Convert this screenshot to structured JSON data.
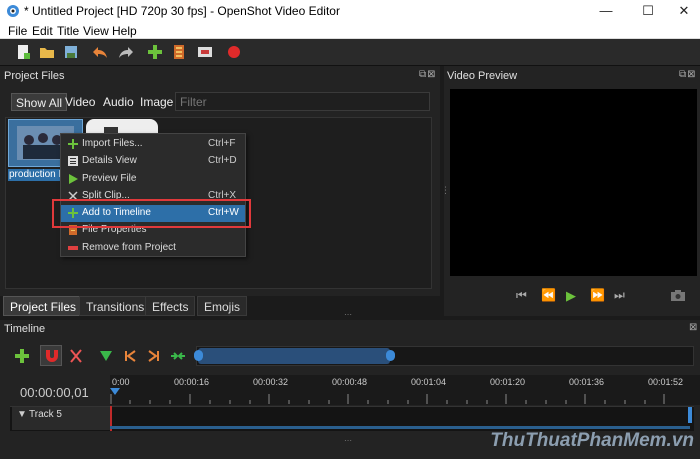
{
  "window": {
    "title": "* Untitled Project [HD 720p 30 fps] - OpenShot Video Editor",
    "minimize": "—",
    "maximize": "☐",
    "close": "✕"
  },
  "menu": [
    "File",
    "Edit",
    "Title",
    "View",
    "Help"
  ],
  "toolbar_icons": [
    "new-project-icon",
    "open-project-icon",
    "save-project-icon",
    "undo-icon",
    "redo-icon",
    "import-files-icon",
    "profile-icon",
    "export-film-icon",
    "record-icon"
  ],
  "project_files": {
    "title": "Project Files",
    "dock_buttons": "⧉⊠",
    "filter_tabs": [
      "Show All",
      "Video",
      "Audio",
      "Image"
    ],
    "filter_placeholder": "Filter",
    "thumbnail_label": "production I"
  },
  "context_menu": {
    "items": [
      {
        "label": "Import Files...",
        "shortcut": "Ctrl+F",
        "icon": "plus-icon"
      },
      {
        "label": "Details View",
        "shortcut": "Ctrl+D",
        "icon": "details-icon"
      },
      {
        "label": "Preview File",
        "shortcut": "",
        "icon": "play-icon"
      },
      {
        "label": "Split Clip...",
        "shortcut": "Ctrl+X",
        "icon": "scissors-icon"
      },
      {
        "label": "Add to Timeline",
        "shortcut": "Ctrl+W",
        "icon": "plus-icon"
      },
      {
        "label": "File Properties",
        "shortcut": "",
        "icon": "properties-icon"
      },
      {
        "label": "Remove from Project",
        "shortcut": "",
        "icon": "remove-icon"
      }
    ],
    "highlighted": "Add to Timeline"
  },
  "bottom_tabs": [
    "Project Files",
    "Transitions",
    "Effects",
    "Emojis"
  ],
  "video_preview": {
    "title": "Video Preview",
    "controls": [
      "⏮",
      "⏪",
      "▶",
      "⏩",
      "⏭"
    ],
    "camera_icon": "camera-icon"
  },
  "timeline": {
    "title": "Timeline",
    "time": "00:00:00,01",
    "ticks": [
      "0:00",
      "00:00:16",
      "00:00:32",
      "00:00:48",
      "00:01:04",
      "00:01:20",
      "00:01:36",
      "00:01:52"
    ],
    "track": "Track 5"
  },
  "watermark": "ThuThuatPhanMem.vn"
}
